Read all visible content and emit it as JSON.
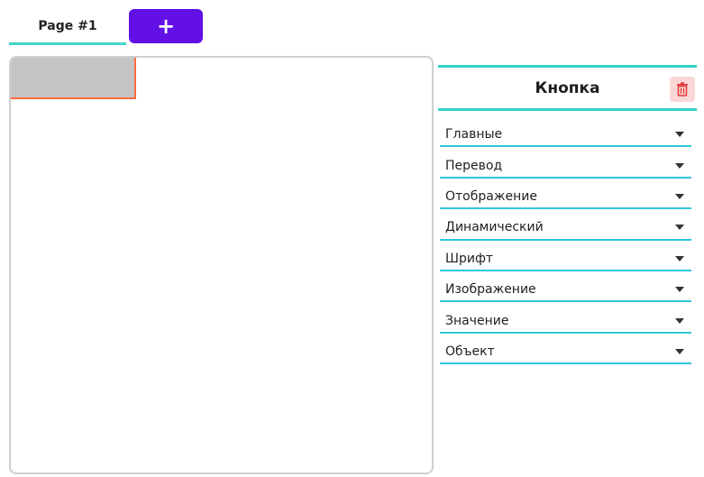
{
  "tabs": [
    {
      "label": "Page #1",
      "active": true
    }
  ],
  "add_page_button": {
    "label": "+"
  },
  "panel": {
    "title": "Кнопка",
    "sections": [
      {
        "label": "Главные"
      },
      {
        "label": "Перевод"
      },
      {
        "label": "Отображение"
      },
      {
        "label": "Динамический"
      },
      {
        "label": "Шрифт"
      },
      {
        "label": "Изображение"
      },
      {
        "label": "Значение"
      },
      {
        "label": "Объект"
      }
    ]
  },
  "icons": {
    "delete": "trash-icon",
    "expand": "chevron-down-icon"
  },
  "colors": {
    "accent": "#6210e6",
    "tab_underline": "#3dd6c8",
    "panel_border": "#2ed3c6",
    "section_underline": "#2ec8de",
    "selection_border": "#ff6a3d",
    "element_fill": "#c4c4c4",
    "delete_bg": "#fbd6d6",
    "delete_icon": "#e23b3b"
  }
}
